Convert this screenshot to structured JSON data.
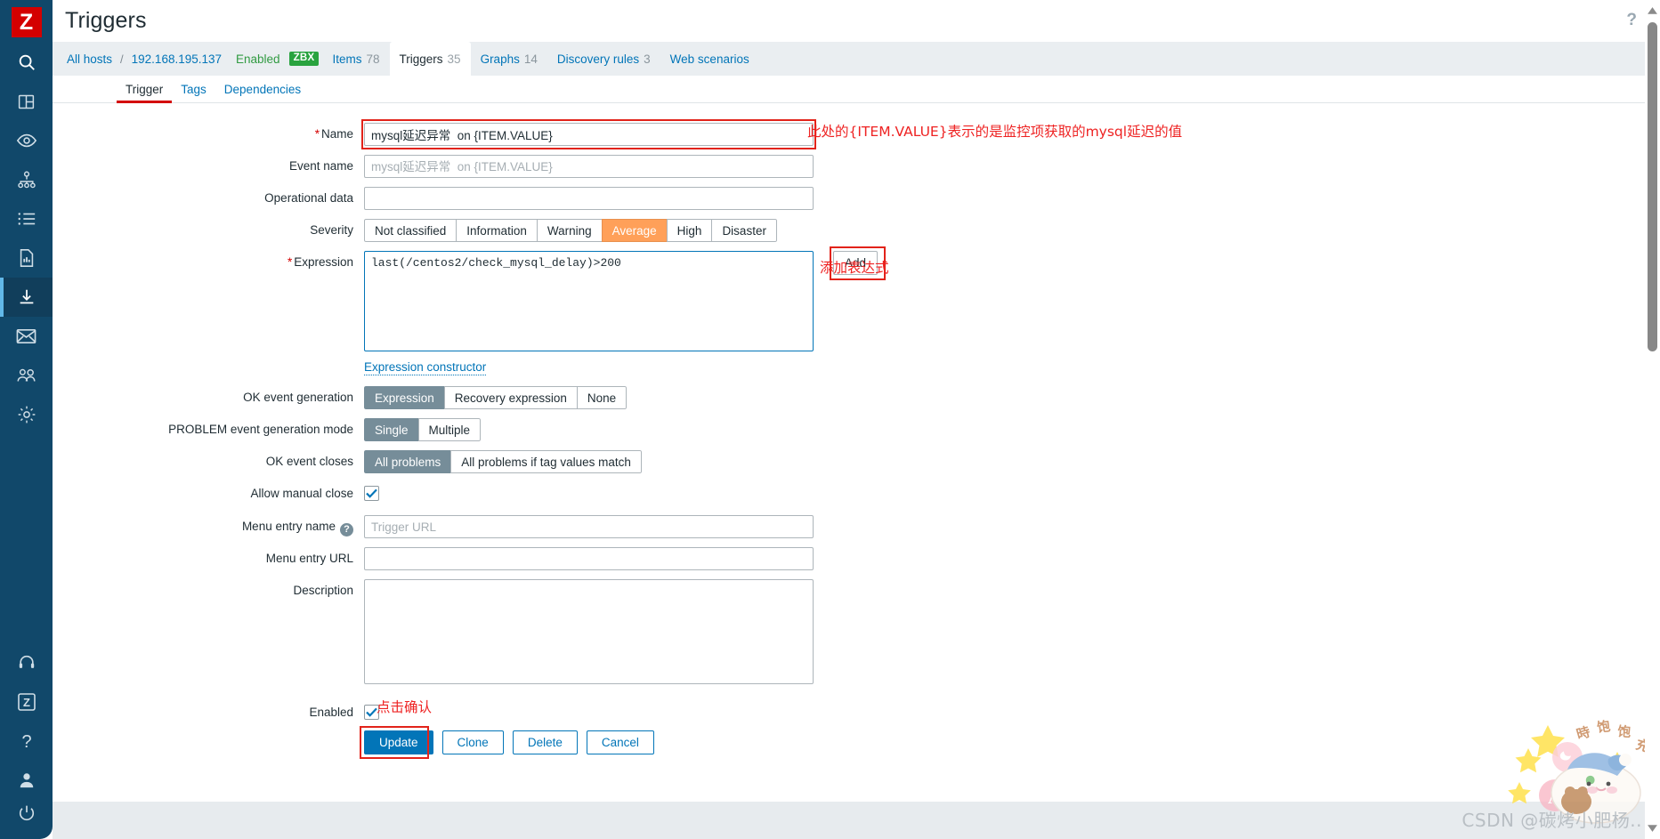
{
  "app": {
    "logo_letter": "Z",
    "page_title": "Triggers",
    "help_icon": "?"
  },
  "sidebar": {
    "items": [
      {
        "name": "search-icon",
        "label": "Search"
      },
      {
        "name": "dashboards-icon",
        "label": "Dashboards"
      },
      {
        "name": "monitoring-eye-icon",
        "label": "Monitoring"
      },
      {
        "name": "services-network-icon",
        "label": "Services"
      },
      {
        "name": "inventory-list-icon",
        "label": "Inventory"
      },
      {
        "name": "reports-icon",
        "label": "Reports"
      },
      {
        "name": "data-collection-icon",
        "label": "Data collection",
        "active": true
      },
      {
        "name": "alerts-envelope-icon",
        "label": "Alerts"
      },
      {
        "name": "users-icon",
        "label": "Users"
      },
      {
        "name": "administration-gear-icon",
        "label": "Administration"
      }
    ],
    "bottom_items": [
      {
        "name": "support-headset-icon",
        "label": "Support"
      },
      {
        "name": "zabbix-integrations-icon",
        "label": "Integrations"
      },
      {
        "name": "help-question-icon",
        "label": "Help"
      },
      {
        "name": "user-profile-icon",
        "label": "User settings"
      },
      {
        "name": "sign-out-power-icon",
        "label": "Sign out"
      }
    ]
  },
  "breadcrumb": {
    "all_hosts": "All hosts",
    "separator": "/",
    "host": "192.168.195.137",
    "status": "Enabled",
    "agent_badge": "ZBX",
    "tabs": [
      {
        "label": "Items",
        "count": "78",
        "current": false
      },
      {
        "label": "Triggers",
        "count": "35",
        "current": true
      },
      {
        "label": "Graphs",
        "count": "14",
        "current": false
      },
      {
        "label": "Discovery rules",
        "count": "3",
        "current": false
      },
      {
        "label": "Web scenarios",
        "count": "",
        "current": false
      }
    ]
  },
  "form_tabs": [
    {
      "label": "Trigger",
      "active": true
    },
    {
      "label": "Tags",
      "active": false
    },
    {
      "label": "Dependencies",
      "active": false
    }
  ],
  "form": {
    "name": {
      "label": "Name",
      "required": true,
      "value": "mysql延迟异常  on {ITEM.VALUE}"
    },
    "event_name": {
      "label": "Event name",
      "value": "",
      "placeholder": "mysql延迟异常  on {ITEM.VALUE}"
    },
    "operational_data": {
      "label": "Operational data",
      "value": "",
      "placeholder": ""
    },
    "severity": {
      "label": "Severity",
      "options": [
        "Not classified",
        "Information",
        "Warning",
        "Average",
        "High",
        "Disaster"
      ],
      "selected": "Average"
    },
    "expression": {
      "label": "Expression",
      "required": true,
      "value": "last(/centos2/check_mysql_delay)>200",
      "add_button": "Add",
      "constructor_link": "Expression constructor"
    },
    "ok_event_generation": {
      "label": "OK event generation",
      "options": [
        "Expression",
        "Recovery expression",
        "None"
      ],
      "selected": "Expression"
    },
    "problem_event_generation_mode": {
      "label": "PROBLEM event generation mode",
      "options": [
        "Single",
        "Multiple"
      ],
      "selected": "Single"
    },
    "ok_event_closes": {
      "label": "OK event closes",
      "options": [
        "All problems",
        "All problems if tag values match"
      ],
      "selected": "All problems"
    },
    "allow_manual_close": {
      "label": "Allow manual close",
      "checked": true
    },
    "menu_entry_name": {
      "label": "Menu entry name",
      "help": "?",
      "value": "",
      "placeholder": "Trigger URL"
    },
    "menu_entry_url": {
      "label": "Menu entry URL",
      "value": "",
      "placeholder": ""
    },
    "description": {
      "label": "Description",
      "value": "",
      "placeholder": ""
    },
    "enabled": {
      "label": "Enabled",
      "checked": true
    },
    "buttons": [
      {
        "label": "Update",
        "primary": true
      },
      {
        "label": "Clone",
        "primary": false
      },
      {
        "label": "Delete",
        "primary": false
      },
      {
        "label": "Cancel",
        "primary": false
      }
    ]
  },
  "annotations": {
    "name_note": "此处的{ITEM.VALUE}表示的是监控项获取的mysql延迟的值",
    "expression_note": "添加表达式",
    "update_note": "点击确认"
  },
  "watermark": {
    "text": "CSDN @碳烤小肥杨.."
  },
  "colors": {
    "sidebar": "#11486a",
    "logo_red": "#d40000",
    "link_blue": "#0275b8",
    "accent_orange": "#ffa059",
    "selected_gray": "#768d99",
    "enabled_green": "#319b42",
    "zbx_green": "#29a33f",
    "annotation_red": "#ee2222"
  }
}
